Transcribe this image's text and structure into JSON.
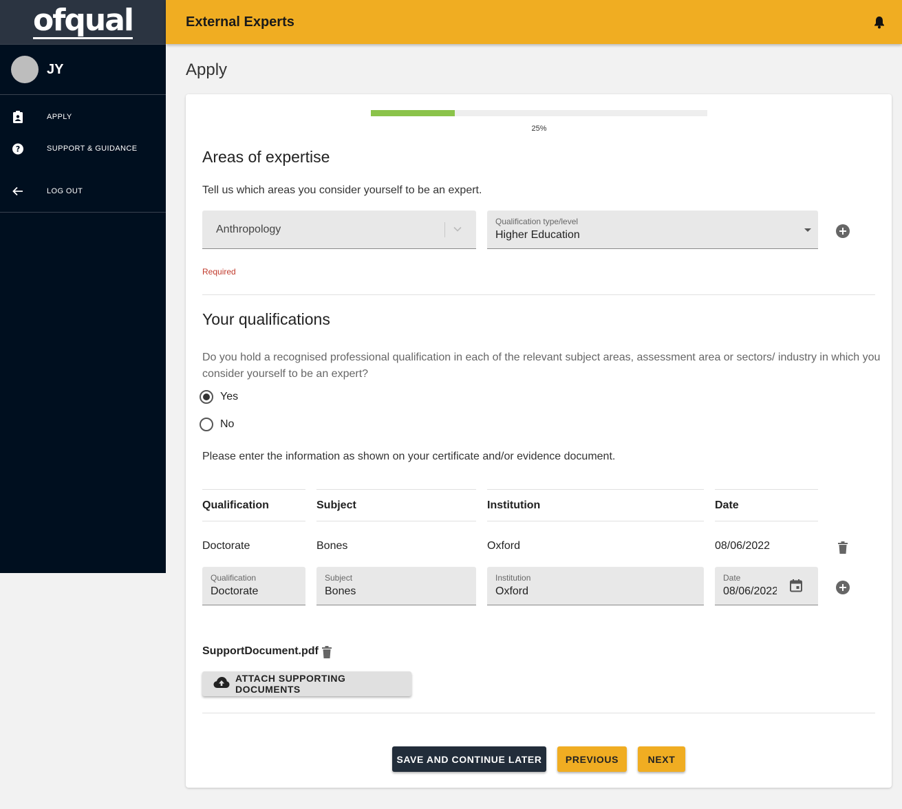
{
  "brand": {
    "logo_text": "ofqual"
  },
  "user": {
    "initials": "JY"
  },
  "sidebar": {
    "items": [
      {
        "label": "APPLY",
        "icon": "assignment-ind-icon"
      },
      {
        "label": "SUPPORT & GUIDANCE",
        "icon": "help-icon"
      },
      {
        "label": "LOG OUT",
        "icon": "arrow-left-icon"
      }
    ]
  },
  "header": {
    "title": "External Experts",
    "icon": "bell-icon"
  },
  "page": {
    "title": "Apply"
  },
  "progress": {
    "value": 25,
    "label": "25%",
    "color": "#8bc34a"
  },
  "expertise": {
    "heading": "Areas of expertise",
    "instruction": "Tell us which areas you consider yourself to be an expert.",
    "subject_value": "Anthropology",
    "qual_type_label": "Qualification type/level",
    "qual_type_value": "Higher Education",
    "required_text": "Required"
  },
  "qualifications": {
    "heading": "Your qualifications",
    "question": "Do you hold a recognised professional qualification in each of the relevant subject areas, assessment area or sectors/ industry in which you consider yourself to be an expert?",
    "options": [
      {
        "label": "Yes",
        "checked": true
      },
      {
        "label": "No",
        "checked": false
      }
    ],
    "instruction": "Please enter the information as shown on your certificate and/or evidence document.",
    "columns": [
      "Qualification",
      "Subject",
      "Institution",
      "Date"
    ],
    "rows": [
      {
        "qualification": "Doctorate",
        "subject": "Bones",
        "institution": "Oxford",
        "date": "08/06/2022"
      }
    ],
    "inputs": {
      "qualification": {
        "label": "Qualification",
        "value": "Doctorate"
      },
      "subject": {
        "label": "Subject",
        "value": "Bones"
      },
      "institution": {
        "label": "Institution",
        "value": "Oxford"
      },
      "date": {
        "label": "Date",
        "value": "08/06/2022"
      }
    }
  },
  "documents": {
    "file_name": "SupportDocument.pdf",
    "attach_label": "ATTACH SUPPORTING DOCUMENTS"
  },
  "actions": {
    "save_label": "SAVE AND CONTINUE LATER",
    "previous_label": "PREVIOUS",
    "next_label": "NEXT"
  },
  "colors": {
    "accent": "#f0ad22",
    "sidebar": "#000f1f",
    "dark_button": "#222d3a",
    "error": "#c0392b"
  }
}
